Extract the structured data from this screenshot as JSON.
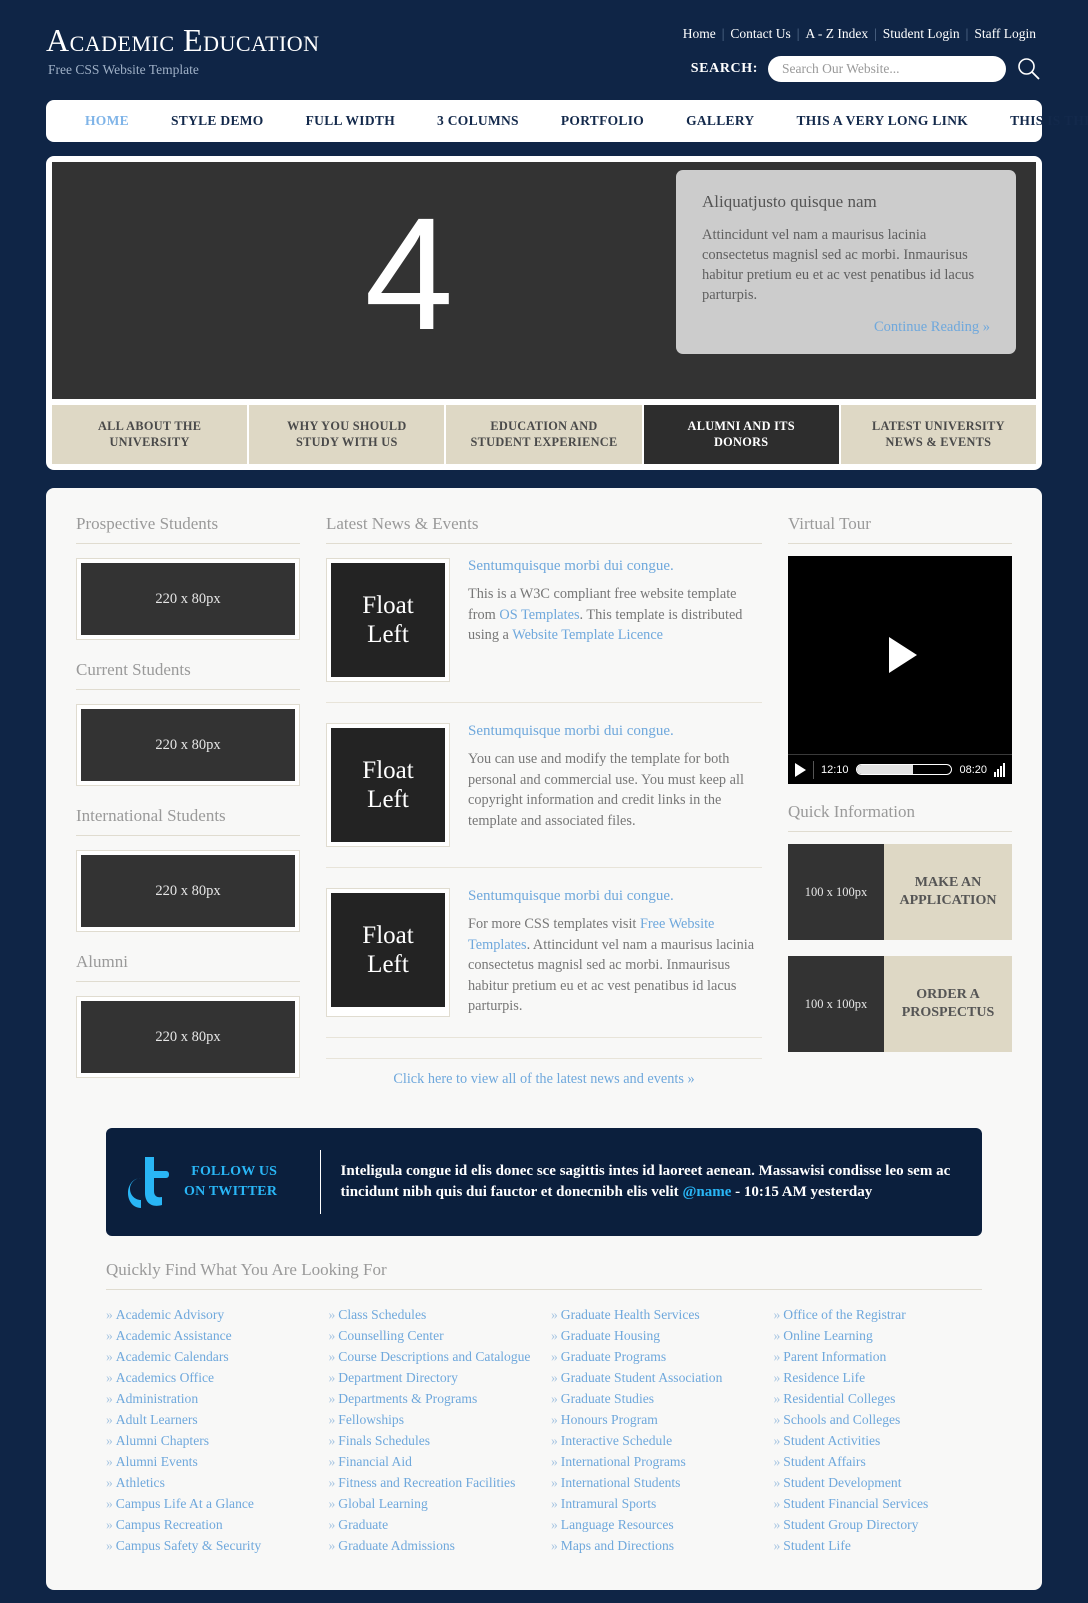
{
  "header": {
    "logo": "Academic Education",
    "tagline": "Free CSS Website Template",
    "toplinks": [
      "Home",
      "Contact Us",
      "A - Z Index",
      "Student Login",
      "Staff Login"
    ],
    "search_label": "SEARCH:",
    "search_placeholder": "Search Our Website...",
    "search_value": ""
  },
  "nav": {
    "items": [
      {
        "label": "HOME",
        "active": true
      },
      {
        "label": "STYLE DEMO",
        "active": false
      },
      {
        "label": "FULL WIDTH",
        "active": false
      },
      {
        "label": "3 COLUMNS",
        "active": false
      },
      {
        "label": "PORTFOLIO",
        "active": false
      },
      {
        "label": "GALLERY",
        "active": false
      },
      {
        "label": "THIS A VERY LONG LINK",
        "active": false
      },
      {
        "label": "THIS IS THE LAST",
        "active": false
      }
    ]
  },
  "hero": {
    "number": "4",
    "caption_title": "Aliquatjusto quisque nam",
    "caption_text": "Attincidunt vel nam a maurisus lacinia consectetus magnisl sed ac morbi. Inmaurisus habitur pretium eu et ac vest penatibus id lacus parturpis.",
    "continue_label": "Continue Reading »",
    "tabs": [
      {
        "line1": "ALL ABOUT THE",
        "line2": "UNIVERSITY",
        "active": false
      },
      {
        "line1": "WHY YOU SHOULD",
        "line2": "STUDY WITH US",
        "active": false
      },
      {
        "line1": "EDUCATION AND",
        "line2": "STUDENT EXPERIENCE",
        "active": false
      },
      {
        "line1": "ALUMNI AND ITS",
        "line2": "DONORS",
        "active": true
      },
      {
        "line1": "LATEST UNIVERSITY",
        "line2": "NEWS & EVENTS",
        "active": false
      }
    ]
  },
  "left_column": {
    "blocks": [
      {
        "heading": "Prospective Students",
        "placeholder": "220 x 80px"
      },
      {
        "heading": "Current Students",
        "placeholder": "220 x 80px"
      },
      {
        "heading": "International Students",
        "placeholder": "220 x 80px"
      },
      {
        "heading": "Alumni",
        "placeholder": "220 x 80px"
      }
    ]
  },
  "news": {
    "heading": "Latest News & Events",
    "thumb_line1": "Float",
    "thumb_line2": "Left",
    "items": [
      {
        "title": "Sentumquisque morbi dui congue.",
        "parts": [
          {
            "t": "This is a W3C compliant free website template from ",
            "link": false
          },
          {
            "t": "OS Templates",
            "link": true
          },
          {
            "t": ". This template is distributed using a ",
            "link": false
          },
          {
            "t": "Website Template Licence",
            "link": true
          }
        ]
      },
      {
        "title": "Sentumquisque morbi dui congue.",
        "parts": [
          {
            "t": "You can use and modify the template for both personal and commercial use. You must keep all copyright information and credit links in the template and associated files.",
            "link": false
          }
        ]
      },
      {
        "title": "Sentumquisque morbi dui congue.",
        "parts": [
          {
            "t": "For more CSS templates visit ",
            "link": false
          },
          {
            "t": "Free Website Templates",
            "link": true
          },
          {
            "t": ". Attincidunt vel nam a maurisus lacinia consectetus magnisl sed ac morbi. Inmaurisus habitur pretium eu et ac vest penatibus id lacus parturpis.",
            "link": false
          }
        ]
      }
    ],
    "all_link": "Click here to view all of the latest news and events »"
  },
  "right_column": {
    "video_heading": "Virtual Tour",
    "video": {
      "current_time": "12:10",
      "total_time": "08:20",
      "progress_percent": 60
    },
    "quick_heading": "Quick Information",
    "quick_items": [
      {
        "image": "100 x 100px",
        "line1": "MAKE AN",
        "line2": "APPLICATION"
      },
      {
        "image": "100 x 100px",
        "line1": "ORDER A",
        "line2": "PROSPECTUS"
      }
    ]
  },
  "twitter": {
    "follow_line1": "FOLLOW US",
    "follow_line2": "ON TWITTER",
    "text_before": "Inteligula congue id elis donec sce sagittis intes id laoreet aenean. Massawisi condisse leo sem ac tincidunt nibh quis dui fauctor et donecnibh elis velit ",
    "handle": "@name",
    "text_after": " - 10:15 AM yesterday"
  },
  "quick_find": {
    "heading": "Quickly Find What You Are Looking For",
    "columns": [
      [
        "Academic Advisory",
        "Academic Assistance",
        "Academic Calendars",
        "Academics Office",
        "Administration",
        "Adult Learners",
        "Alumni Chapters",
        "Alumni Events",
        "Athletics",
        "Campus Life At a Glance",
        "Campus Recreation",
        "Campus Safety & Security"
      ],
      [
        "Class Schedules",
        "Counselling Center",
        "Course Descriptions and Catalogue",
        "Department Directory",
        "Departments & Programs",
        "Fellowships",
        "Finals Schedules",
        "Financial Aid",
        "Fitness and Recreation Facilities",
        "Global Learning",
        "Graduate",
        "Graduate Admissions"
      ],
      [
        "Graduate Health Services",
        "Graduate Housing",
        "Graduate Programs",
        "Graduate Student Association",
        "Graduate Studies",
        "Honours Program",
        "Interactive Schedule",
        "International Programs",
        "International Students",
        "Intramural Sports",
        "Language Resources",
        "Maps and Directions"
      ],
      [
        "Office of the Registrar",
        "Online Learning",
        "Parent Information",
        "Residence Life",
        "Residential Colleges",
        "Schools and Colleges",
        "Student Activities",
        "Student Affairs",
        "Student Development",
        "Student Financial Services",
        "Student Group Directory",
        "Student Life"
      ]
    ]
  },
  "colors": {
    "page_bg": "#0f2546",
    "accent_link": "#6fa8dc",
    "tab_bg": "#ded8c5",
    "dark_panel": "#333333",
    "twitter_blue": "#29b6f6"
  }
}
